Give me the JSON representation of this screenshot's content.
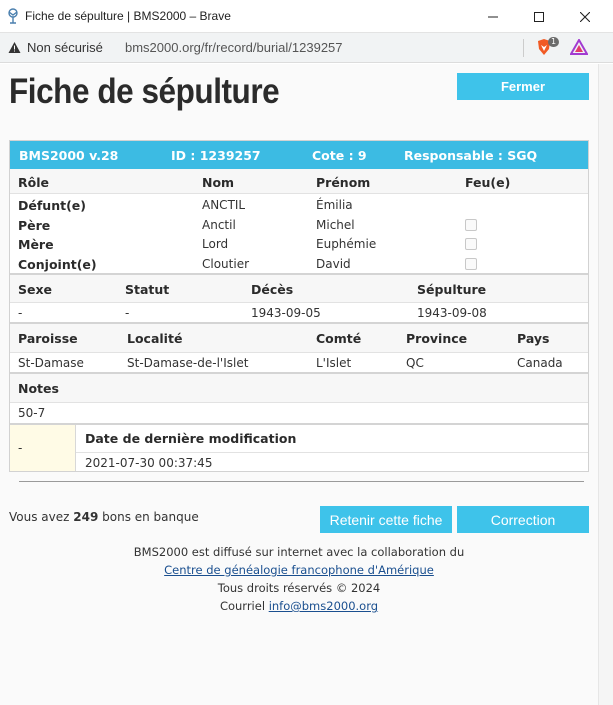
{
  "window": {
    "title": "Fiche de sépulture | BMS2000 – Brave",
    "security_label": "Non sécurisé",
    "url": "bms2000.org/fr/record/burial/1239257",
    "brave_badge": "1"
  },
  "page": {
    "title": "Fiche de sépulture",
    "close_label": "Fermer"
  },
  "record": {
    "header": {
      "version": "BMS2000 v.28",
      "id": "ID : 1239257",
      "cote": "Cote : 9",
      "responsable": "Responsable : SGQ"
    },
    "persons": {
      "columns": [
        "Rôle",
        "Nom",
        "Prénom",
        "Feu(e)"
      ],
      "rows": [
        {
          "role": "Défunt(e)",
          "nom": "ANCTIL",
          "prenom": "Émilia",
          "feu": null
        },
        {
          "role": "Père",
          "nom": "Anctil",
          "prenom": "Michel",
          "feu": false
        },
        {
          "role": "Mère",
          "nom": "Lord",
          "prenom": "Euphémie",
          "feu": false
        },
        {
          "role": "Conjoint(e)",
          "nom": "Cloutier",
          "prenom": "David",
          "feu": false
        }
      ]
    },
    "details": {
      "columns": [
        "Sexe",
        "Statut",
        "Décès",
        "Sépulture"
      ],
      "values": [
        "-",
        "-",
        "1943-09-05",
        "1943-09-08"
      ]
    },
    "place": {
      "columns": [
        "Paroisse",
        "Localité",
        "Comté",
        "Province",
        "Pays"
      ],
      "values": [
        "St-Damase",
        "St-Damase-de-l'Islet",
        "L'Islet",
        "QC",
        "Canada"
      ]
    },
    "notes": {
      "label": "Notes",
      "value": "50-7"
    },
    "modification": {
      "side_value": "-",
      "label": "Date de dernière modification",
      "value": "2021-07-30 00:37:45"
    }
  },
  "bank": {
    "prefix": "Vous avez ",
    "count": "249",
    "suffix": " bons en banque"
  },
  "actions": {
    "keep_label": "Retenir cette fiche",
    "correction_label": "Correction"
  },
  "footer": {
    "line1": "BMS2000 est diffusé sur internet avec la collaboration du",
    "link": "Centre de généalogie francophone d'Amérique",
    "rights": "Tous droits réservés © 2024",
    "email_prefix": "Courriel ",
    "email": "info@bms2000.org"
  },
  "colors": {
    "accent": "#3cbbe3",
    "link": "#1a4f8f",
    "mod_highlight": "#fffbe6"
  }
}
